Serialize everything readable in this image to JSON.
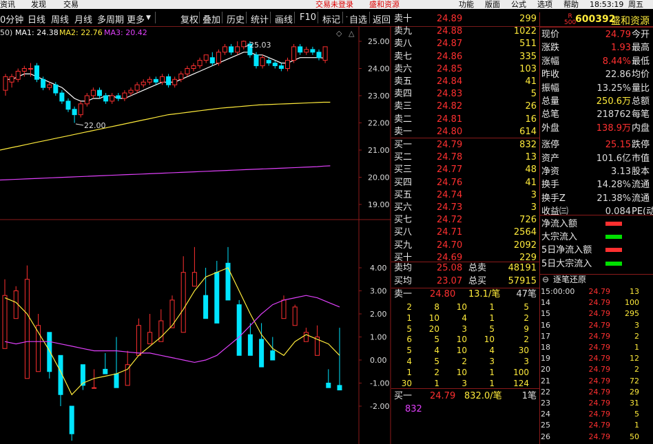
{
  "menubar": {
    "items": [
      "资讯",
      "发现",
      "交易"
    ],
    "login": "交易未登录",
    "stock": "盛和资源",
    "right": [
      "功能",
      "版面",
      "公式",
      "选项",
      "帮助"
    ],
    "time": "18:53:19",
    "weekday": "周五"
  },
  "toolbar": {
    "left": [
      "0分钟",
      "日线",
      "周线",
      "月线",
      "多周期",
      "更多"
    ],
    "tools": [
      "复权",
      "叠加",
      "历史",
      "统计",
      "画线",
      "F10",
      "标记",
      "自选",
      "返回"
    ]
  },
  "chart": {
    "ma_label": "50)",
    "ma1": "MA1: 24.38",
    "ma2": "MA2: 22.76",
    "ma3": "MA3: 20.42",
    "high_label": "25.03",
    "low_label": "22.00",
    "price_axis": [
      "25.00",
      "24.00",
      "23.00",
      "22.00",
      "21.00",
      "20.00",
      "19.00"
    ],
    "ind_axis": [
      "4.00",
      "3.00",
      "2.00",
      "1.00",
      "0.00",
      "-1.00",
      "-2.00"
    ]
  },
  "chart_data": {
    "type": "candlestick",
    "colors": {
      "up": "#ff3030",
      "down": "#00e5ff",
      "ma1": "#ffffff",
      "ma2": "#ffeb3b",
      "ma3": "#e040fb"
    },
    "candles": [
      [
        23.2,
        23.7,
        23.0,
        23.8
      ],
      [
        23.5,
        23.7,
        23.3,
        23.8
      ],
      [
        23.6,
        23.9,
        23.5,
        24.0
      ],
      [
        23.9,
        24.0,
        23.7,
        24.1
      ],
      [
        24.0,
        24.0,
        23.7,
        24.2
      ],
      [
        24.1,
        23.6,
        23.5,
        24.2
      ],
      [
        23.6,
        23.3,
        23.2,
        23.7
      ],
      [
        23.3,
        23.4,
        23.2,
        23.5
      ],
      [
        23.4,
        23.1,
        23.0,
        23.5
      ],
      [
        23.1,
        22.8,
        22.7,
        23.2
      ],
      [
        22.8,
        22.5,
        22.4,
        22.9
      ],
      [
        22.5,
        22.3,
        22.0,
        22.6
      ],
      [
        22.3,
        22.7,
        22.2,
        22.8
      ],
      [
        22.7,
        23.0,
        22.6,
        23.1
      ],
      [
        23.0,
        23.2,
        22.9,
        23.3
      ],
      [
        23.2,
        23.0,
        22.9,
        23.3
      ],
      [
        23.0,
        22.8,
        22.7,
        23.1
      ],
      [
        22.8,
        23.0,
        22.7,
        23.1
      ],
      [
        23.0,
        22.9,
        22.8,
        23.1
      ],
      [
        22.9,
        23.1,
        22.8,
        23.2
      ],
      [
        23.1,
        23.2,
        23.0,
        23.3
      ],
      [
        23.2,
        23.4,
        23.1,
        23.5
      ],
      [
        23.4,
        23.5,
        23.3,
        23.6
      ],
      [
        23.5,
        23.6,
        23.4,
        23.7
      ],
      [
        23.6,
        23.5,
        23.4,
        23.7
      ],
      [
        23.5,
        23.7,
        23.4,
        23.8
      ],
      [
        23.7,
        23.4,
        23.3,
        23.8
      ],
      [
        23.4,
        23.6,
        23.3,
        23.7
      ],
      [
        23.6,
        23.8,
        23.5,
        23.9
      ],
      [
        23.8,
        24.0,
        23.7,
        24.1
      ],
      [
        24.0,
        24.1,
        23.9,
        24.2
      ],
      [
        24.1,
        24.3,
        24.0,
        24.4
      ],
      [
        24.3,
        24.5,
        24.2,
        24.5
      ],
      [
        24.4,
        24.2,
        24.1,
        24.6
      ],
      [
        24.2,
        24.6,
        24.1,
        24.7
      ],
      [
        24.6,
        24.8,
        24.5,
        24.9
      ],
      [
        24.8,
        24.6,
        24.5,
        24.9
      ],
      [
        24.6,
        24.8,
        24.5,
        25.0
      ],
      [
        24.8,
        25.0,
        24.7,
        25.03
      ],
      [
        24.9,
        24.5,
        24.4,
        25.0
      ],
      [
        24.5,
        24.1,
        24.0,
        24.6
      ],
      [
        24.1,
        24.4,
        24.0,
        24.5
      ],
      [
        24.3,
        24.2,
        24.1,
        24.4
      ],
      [
        24.2,
        24.1,
        24.0,
        24.3
      ],
      [
        24.1,
        24.0,
        23.9,
        24.2
      ],
      [
        24.0,
        24.3,
        23.9,
        24.4
      ],
      [
        24.3,
        24.8,
        24.2,
        24.9
      ],
      [
        24.8,
        24.6,
        24.5,
        24.9
      ],
      [
        24.6,
        24.7,
        24.5,
        24.8
      ],
      [
        24.7,
        24.6,
        24.5,
        24.8
      ],
      [
        24.6,
        24.4,
        24.3,
        24.7
      ],
      [
        24.3,
        24.8,
        24.2,
        24.8
      ]
    ],
    "ma1": [
      23.6,
      23.6,
      23.7,
      23.8,
      23.8,
      23.7,
      23.6,
      23.5,
      23.4,
      23.3,
      23.1,
      22.9,
      22.8,
      22.8,
      22.9,
      22.9,
      23.0,
      23.0,
      22.9,
      22.9,
      23.0,
      23.1,
      23.2,
      23.3,
      23.4,
      23.5,
      23.5,
      23.5,
      23.6,
      23.7,
      23.8,
      23.9,
      24.0,
      24.1,
      24.2,
      24.3,
      24.4,
      24.5,
      24.6,
      24.6,
      24.5,
      24.5,
      24.4,
      24.3,
      24.2,
      24.2,
      24.3,
      24.4,
      24.4,
      24.4,
      24.4,
      24.38
    ],
    "ma2": [
      21.0,
      21.05,
      21.1,
      21.15,
      21.2,
      21.25,
      21.3,
      21.35,
      21.4,
      21.45,
      21.5,
      21.55,
      21.6,
      21.65,
      21.7,
      21.75,
      21.8,
      21.85,
      21.9,
      21.95,
      22.0,
      22.05,
      22.1,
      22.15,
      22.2,
      22.25,
      22.3,
      22.33,
      22.36,
      22.39,
      22.42,
      22.45,
      22.48,
      22.51,
      22.54,
      22.56,
      22.58,
      22.6,
      22.62,
      22.64,
      22.66,
      22.67,
      22.68,
      22.69,
      22.7,
      22.71,
      22.72,
      22.73,
      22.74,
      22.75,
      22.76,
      22.76
    ],
    "ma3": [
      19.9,
      19.91,
      19.92,
      19.93,
      19.94,
      19.95,
      19.96,
      19.97,
      19.98,
      19.99,
      20.0,
      20.01,
      20.02,
      20.03,
      20.04,
      20.05,
      20.06,
      20.07,
      20.08,
      20.09,
      20.1,
      20.11,
      20.12,
      20.13,
      20.14,
      20.15,
      20.16,
      20.17,
      20.18,
      20.19,
      20.2,
      20.21,
      20.22,
      20.23,
      20.24,
      20.25,
      20.26,
      20.27,
      20.28,
      20.29,
      20.3,
      20.31,
      20.32,
      20.33,
      20.34,
      20.35,
      20.36,
      20.37,
      20.38,
      20.39,
      20.41,
      20.42
    ],
    "ind_bars": [
      [
        0.5,
        2.8,
        3.5
      ],
      [
        1.8,
        3.0,
        3.2
      ],
      [
        -0.8,
        3.5,
        4.1
      ],
      [
        -0.5,
        1.5,
        2.0
      ],
      [
        1.2,
        -0.5,
        -0.8
      ],
      [
        0.2,
        -1.5,
        -2.0
      ],
      [
        -2.0,
        -3.2,
        -3.5
      ],
      [
        -0.2,
        -1.1,
        -1.3
      ],
      [
        -1.2,
        -1.2,
        -0.4
      ],
      [
        -0.4,
        -0.6,
        0.3
      ],
      [
        -0.6,
        -1.2,
        1.0
      ],
      [
        -1.1,
        -0.2,
        0.4
      ],
      [
        0.2,
        1.5,
        1.8
      ],
      [
        0.7,
        1.2,
        2.0
      ],
      [
        0.8,
        1.7,
        2.2
      ],
      [
        1.4,
        2.6,
        2.8
      ],
      [
        1.2,
        3.8,
        4.5
      ],
      [
        3.2,
        3.8,
        4.9
      ],
      [
        2.8,
        1.8,
        4.0
      ],
      [
        3.8,
        1.6,
        4.3
      ],
      [
        4.2,
        2.6,
        4.9
      ],
      [
        2.4,
        0.2,
        2.6
      ],
      [
        1.1,
        0.2,
        1.6
      ],
      [
        0.9,
        -0.3,
        1.6
      ],
      [
        0.4,
        0.0,
        1.0
      ],
      [
        1.8,
        2.6,
        2.8
      ],
      [
        1.5,
        2.3,
        2.4
      ],
      [
        0.8,
        1.2,
        1.4
      ],
      [
        0.2,
        1.0,
        1.5
      ],
      [
        -1.0,
        -1.2,
        -0.4
      ],
      [
        -1.1,
        -1.3,
        1.4
      ]
    ],
    "ind_ma1": [
      2.7,
      2.5,
      2.0,
      1.2,
      0.4,
      -0.5,
      -1.5,
      -1.0,
      -0.8,
      -0.7,
      -0.6,
      -0.4,
      0.2,
      0.6,
      1.0,
      1.5,
      2.2,
      3.0,
      3.6,
      3.8,
      4.0,
      3.0,
      2.0,
      1.1,
      0.5,
      0.2,
      0.8,
      1.1,
      0.9,
      0.7,
      0.2
    ],
    "ind_ma3": [
      0.8,
      0.7,
      0.8,
      0.8,
      0.8,
      0.7,
      0.6,
      0.5,
      0.4,
      0.4,
      0.4,
      0.35,
      0.3,
      0.3,
      0.2,
      0.1,
      0.0,
      -0.1,
      0.0,
      0.2,
      0.6,
      1.0,
      1.5,
      2.0,
      2.4,
      2.6,
      2.7,
      2.8,
      2.7,
      2.5,
      2.3
    ]
  },
  "ask": [
    {
      "l": "卖十",
      "p": "24.89",
      "v": "299"
    },
    {
      "l": "卖九",
      "p": "24.88",
      "v": "1022"
    },
    {
      "l": "卖八",
      "p": "24.87",
      "v": "511"
    },
    {
      "l": "卖七",
      "p": "24.86",
      "v": "335"
    },
    {
      "l": "卖六",
      "p": "24.85",
      "v": "103"
    },
    {
      "l": "卖五",
      "p": "24.84",
      "v": "41"
    },
    {
      "l": "卖四",
      "p": "24.83",
      "v": "5"
    },
    {
      "l": "卖三",
      "p": "24.82",
      "v": "26"
    },
    {
      "l": "卖二",
      "p": "24.81",
      "v": "16"
    },
    {
      "l": "卖一",
      "p": "24.80",
      "v": "614"
    }
  ],
  "bid": [
    {
      "l": "买一",
      "p": "24.79",
      "v": "832"
    },
    {
      "l": "买二",
      "p": "24.78",
      "v": "13"
    },
    {
      "l": "买三",
      "p": "24.77",
      "v": "48"
    },
    {
      "l": "买四",
      "p": "24.76",
      "v": "41"
    },
    {
      "l": "买五",
      "p": "24.74",
      "v": "3"
    },
    {
      "l": "买六",
      "p": "24.73",
      "v": "3"
    },
    {
      "l": "买七",
      "p": "24.72",
      "v": "726"
    },
    {
      "l": "买八",
      "p": "24.71",
      "v": "2564"
    },
    {
      "l": "买九",
      "p": "24.70",
      "v": "2092"
    },
    {
      "l": "买十",
      "p": "24.69",
      "v": "229"
    }
  ],
  "avg": {
    "sell_avg_label": "卖均",
    "sell_avg": "25.08",
    "sell_total_label": "总卖",
    "sell_total": "48191",
    "buy_avg_label": "买均",
    "buy_avg": "23.07",
    "buy_total_label": "总买",
    "buy_total": "57915"
  },
  "queue_sell": {
    "label": "卖一",
    "price": "24.80",
    "info": "13.1/笔",
    "count": "47笔"
  },
  "queue_rows": [
    [
      "2",
      "8",
      "10",
      "1",
      "5"
    ],
    [
      "1",
      "10",
      "4",
      "1",
      "2"
    ],
    [
      "5",
      "20",
      "3",
      "5",
      "9"
    ],
    [
      "6",
      "5",
      "10",
      "10",
      "2"
    ],
    [
      "5",
      "4",
      "10",
      "4",
      "30"
    ],
    [
      "4",
      "5",
      "2",
      "3",
      "3"
    ],
    [
      "1",
      "2",
      "10",
      "1",
      "100"
    ],
    [
      "30",
      "1",
      "3",
      "1",
      "124"
    ]
  ],
  "queue_buy": {
    "label": "买一",
    "price": "24.79",
    "info": "832.0/笔",
    "count": "1笔",
    "value": "832"
  },
  "stock": {
    "code": "600392",
    "name": "盛和资源",
    "badge_r": "R",
    "badge_n": "500"
  },
  "info_rows": [
    [
      "现价",
      "24.79",
      "今开"
    ],
    [
      "涨跌",
      "1.93",
      "最高"
    ],
    [
      "涨幅",
      "8.44%",
      "最低"
    ],
    [
      "昨收",
      "22.86",
      "均价"
    ],
    [
      "振幅",
      "13.25%",
      "量比"
    ],
    [
      "总量",
      "250.6万",
      "总额"
    ],
    [
      "总笔",
      "218762",
      "每笔"
    ],
    [
      "外盘",
      "138.9万",
      "内盘"
    ],
    [
      "涨停",
      "25.15",
      "跌停"
    ],
    [
      "资产",
      "101.6亿",
      "市值"
    ],
    [
      "净资",
      "3.13",
      "股本"
    ],
    [
      "换手",
      "14.28%",
      "流通"
    ],
    [
      "换手Z",
      "21.38%",
      "流通"
    ],
    [
      "收益㈢",
      "0.084",
      "PE(动"
    ]
  ],
  "flows": [
    {
      "label": "净流入额",
      "color": "#ff3030"
    },
    {
      "label": "大宗流入",
      "color": "#00e000"
    },
    {
      "label": "5日净流入额",
      "color": "#ff3030"
    },
    {
      "label": "5日大宗流入",
      "color": "#00e000"
    }
  ],
  "ticks_title": "逐笔还原",
  "ticks": [
    [
      "15:00:00",
      "24.79",
      "13"
    ],
    [
      "14",
      "24.79",
      "100"
    ],
    [
      "15",
      "24.79",
      "295"
    ],
    [
      "16",
      "24.79",
      "3"
    ],
    [
      "17",
      "24.79",
      "2"
    ],
    [
      "18",
      "24.79",
      "1"
    ],
    [
      "19",
      "24.79",
      "12"
    ],
    [
      "20",
      "24.79",
      "2"
    ],
    [
      "21",
      "24.79",
      "72"
    ],
    [
      "22",
      "24.79",
      "29"
    ],
    [
      "23",
      "24.79",
      "31"
    ],
    [
      "24",
      "24.79",
      "5"
    ],
    [
      "25",
      "24.79",
      "1"
    ],
    [
      "26",
      "24.79",
      "50"
    ]
  ]
}
